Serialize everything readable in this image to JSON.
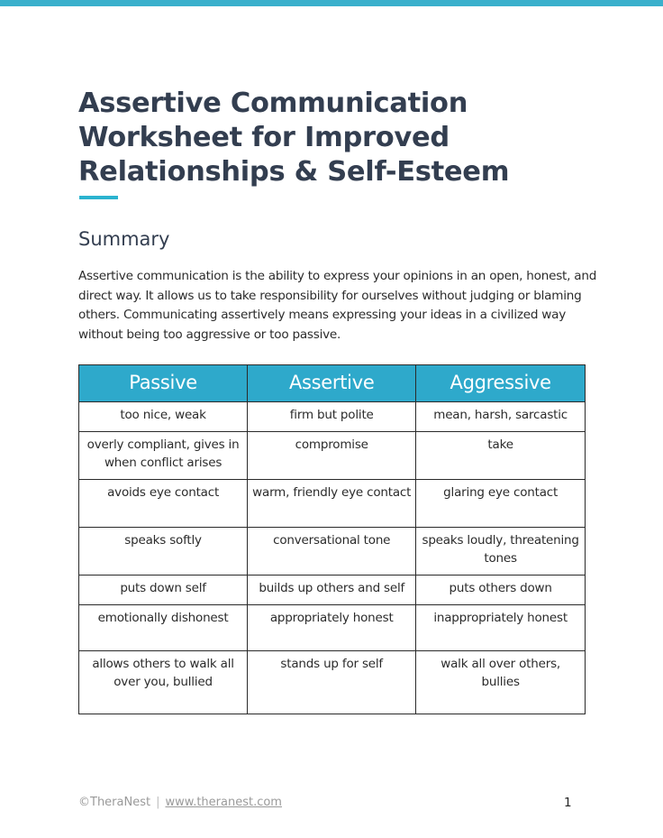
{
  "document": {
    "title": "Assertive Communication Worksheet for Improved Relationships & Self-Esteem",
    "accent_color": "#2ea9cb",
    "summary_heading": "Summary",
    "summary_text": "Assertive communication is the ability to express your opinions in an open, honest, and direct way. It allows us to take responsibility for ourselves without judging or blaming others. Communicating assertively means expressing your ideas in a civilized way without being too aggressive or too passive."
  },
  "table": {
    "headers": [
      "Passive",
      "Assertive",
      "Aggressive"
    ],
    "rows": [
      [
        "too nice, weak",
        "firm but polite",
        "mean, harsh, sarcastic"
      ],
      [
        "overly compliant, gives in when conflict arises",
        "compromise",
        "take"
      ],
      [
        "avoids eye contact",
        "warm, friendly eye contact",
        "glaring eye contact"
      ],
      [
        "speaks softly",
        "conversational tone",
        "speaks loudly, threatening tones"
      ],
      [
        "puts down self",
        "builds up others and self",
        "puts others down"
      ],
      [
        "emotionally dishonest",
        "appropriately honest",
        "inappropriately honest"
      ],
      [
        "allows others to walk all over you, bullied",
        "stands up for self",
        "walk all over others, bullies"
      ]
    ]
  },
  "footer": {
    "copyright": "©TheraNest",
    "separator": "|",
    "link_text": "www.theranest.com",
    "page_number": "1"
  }
}
